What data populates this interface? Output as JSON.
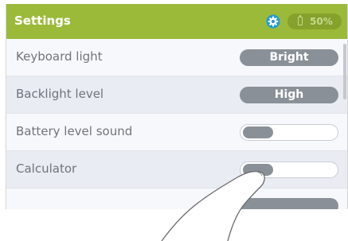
{
  "header": {
    "title": "Settings",
    "icons": [
      "gear-icon",
      "battery-icon"
    ],
    "battery_percent": "50%",
    "accent_color": "#9cba3a"
  },
  "settings": [
    {
      "label": "Keyboard light",
      "control": "pill",
      "value": "Bright"
    },
    {
      "label": "Backlight level",
      "control": "pill",
      "value": "High"
    },
    {
      "label": "Battery level sound",
      "control": "toggle",
      "value": "off"
    },
    {
      "label": "Calculator",
      "control": "toggle",
      "value": "off"
    }
  ]
}
